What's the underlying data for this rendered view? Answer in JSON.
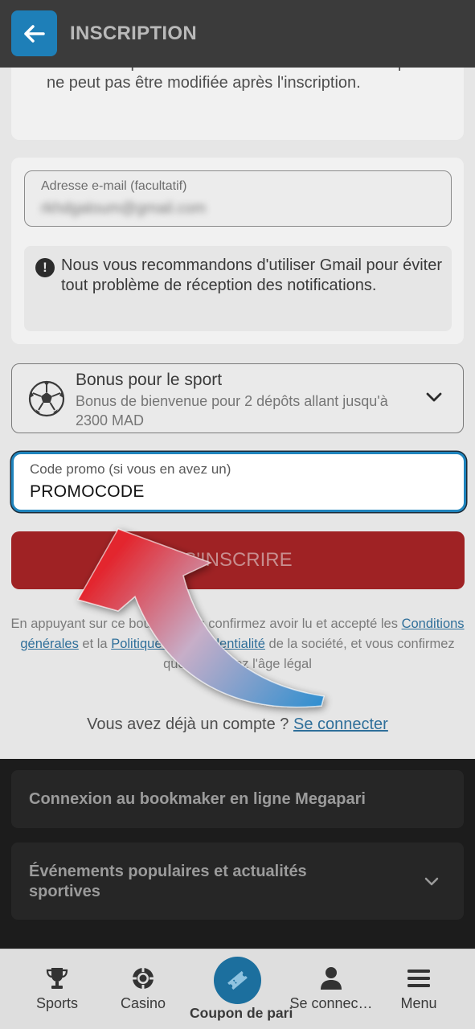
{
  "header": {
    "title": "INSCRIPTION"
  },
  "currency_note": {
    "text": "faire des dépôts et des retraits. La devise du compte ne peut pas être modifiée après l'inscription."
  },
  "email": {
    "label": "Adresse e-mail (facultatif)",
    "value": "rkhdgaloum@gmail.com"
  },
  "notice": {
    "text": "Nous vous recommandons d'utiliser Gmail pour éviter tout problème de réception des notifications."
  },
  "bonus": {
    "title": "Bonus pour le sport",
    "description": "Bonus de bienvenue pour 2 dépôts allant jusqu'à 2300 MAD"
  },
  "promo": {
    "label": "Code promo (si vous en avez un)",
    "value": "PROMOCODE"
  },
  "submit": {
    "label": "S'INSCRIRE"
  },
  "terms": {
    "prefix": "En appuyant sur ce bouton, vous confirmez avoir lu et accepté les",
    "link1": "Conditions générales",
    "connector": "et la",
    "link2": "Politique de confidentialité",
    "suffix": "de la société, et vous confirmez que vous avez l'âge légal"
  },
  "login": {
    "text": "Vous avez déjà un compte ?",
    "link": "Se connecter"
  },
  "accordions": [
    {
      "title": "Connexion au bookmaker en ligne Megapari"
    },
    {
      "title": "Événements populaires et actualités sportives"
    }
  ],
  "bottom_nav": [
    {
      "label": "Sports",
      "icon": "trophy-icon"
    },
    {
      "label": "Casino",
      "icon": "casino-chip-icon"
    },
    {
      "label": "Coupon de pari",
      "icon": "ticket-icon"
    },
    {
      "label": "Se connec…",
      "icon": "user-icon"
    },
    {
      "label": "Menu",
      "icon": "hamburger-icon"
    }
  ],
  "colors": {
    "accent": "#1f84bd",
    "submit": "#9f2224",
    "header": "#3b3b3b"
  }
}
